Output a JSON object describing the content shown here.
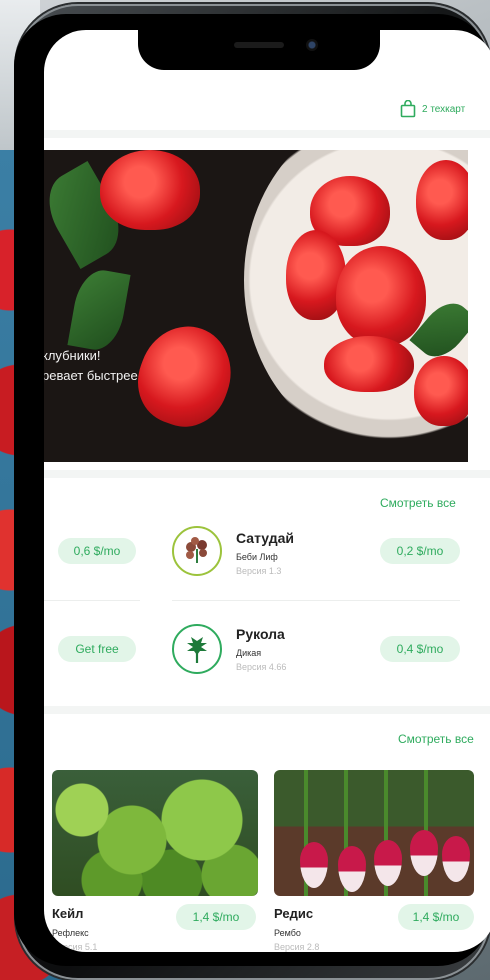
{
  "header": {
    "cart_label": "2 техкарт",
    "cart_icon": "shopping-bag-icon"
  },
  "hero": {
    "line1": "клубники!",
    "line2": "ревает быстрее"
  },
  "techcards": {
    "see_all": "Смотреть все",
    "items": [
      {
        "name": "",
        "variety": "",
        "version": "",
        "price": "0,6 $/mo"
      },
      {
        "name": "Сатудай",
        "variety": "Беби Лиф",
        "version": "Версия 1.3",
        "price": "0,2 $/mo",
        "icon": "lettuce-icon"
      },
      {
        "name": "",
        "variety": "",
        "version": "",
        "price": "Get free"
      },
      {
        "name": "Рукола",
        "variety": "Дикая",
        "version": "Версия 4.66",
        "price": "0,4 $/mo",
        "icon": "arugula-icon"
      }
    ]
  },
  "products": {
    "see_all": "Смотреть все",
    "cards": [
      {
        "name": "Кейл",
        "variety": "Рефлекс",
        "version": "Версия 5.1",
        "price": "1,4 $/mo"
      },
      {
        "name": "Редис",
        "variety": "Рембо",
        "version": "Версия 2.8",
        "price": "1,4 $/mo"
      }
    ]
  },
  "colors": {
    "accent": "#2fab5e",
    "pill_bg": "#e2f5e8"
  }
}
